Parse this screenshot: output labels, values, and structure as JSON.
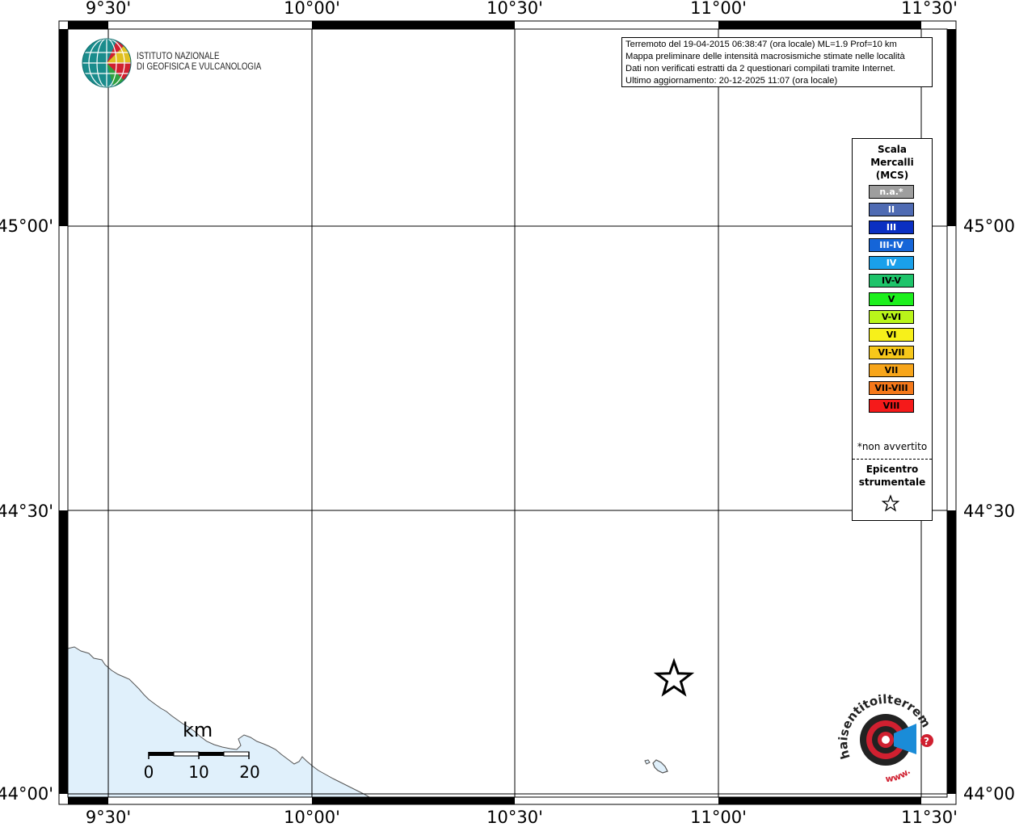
{
  "top_labels": [
    "9°30'",
    "10°00'",
    "10°30'",
    "11°00'",
    "11°30'"
  ],
  "bottom_labels": [
    "9°30'",
    "10°00'",
    "10°30'",
    "11°00'",
    "11°30'"
  ],
  "left_labels": [
    "45°00'",
    "44°30'",
    "44°00'"
  ],
  "right_labels": [
    "45°00'",
    "44°30'",
    "44°00'"
  ],
  "info": {
    "line1": "Terremoto del 19-04-2015 06:38:47 (ora locale) ML=1.9 Prof=10 km",
    "line2": "Mappa preliminare delle intensità macrosismiche stimate nelle località",
    "line3": "Dati non verificati estratti da 2 questionari compilati tramite Internet.",
    "line4": "Ultimo aggiornamento: 20-12-2025 11:07 (ora locale)"
  },
  "legend": {
    "title1": "Scala",
    "title2": "Mercalli",
    "title3": "(MCS)",
    "items": [
      {
        "label": "n.a.*",
        "color": "#9e9e9e",
        "text_color": "#ffffff"
      },
      {
        "label": "II",
        "color": "#4f6bb3",
        "text_color": "#ffffff"
      },
      {
        "label": "III",
        "color": "#0a2fc2",
        "text_color": "#ffffff"
      },
      {
        "label": "III-IV",
        "color": "#1565d8",
        "text_color": "#ffffff"
      },
      {
        "label": "IV",
        "color": "#1aa0ea",
        "text_color": "#ffffff"
      },
      {
        "label": "IV-V",
        "color": "#1ec46a",
        "text_color": "#000000"
      },
      {
        "label": "V",
        "color": "#1cf01c",
        "text_color": "#000000"
      },
      {
        "label": "V-VI",
        "color": "#b9f51a",
        "text_color": "#000000"
      },
      {
        "label": "VI",
        "color": "#f7f01a",
        "text_color": "#000000"
      },
      {
        "label": "VI-VII",
        "color": "#f7c81a",
        "text_color": "#000000"
      },
      {
        "label": "VII",
        "color": "#f7a51a",
        "text_color": "#000000"
      },
      {
        "label": "VII-VIII",
        "color": "#f5781a",
        "text_color": "#000000"
      },
      {
        "label": "VIII",
        "color": "#f51a1a",
        "text_color": "#000000"
      }
    ],
    "note": "*non avvertito",
    "epicenter1": "Epicentro",
    "epicenter2": "strumentale"
  },
  "logo": {
    "line1": "ISTITUTO NAZIONALE",
    "line2": "DI GEOFISICA E VULCANOLOGIA"
  },
  "scale_bar": {
    "unit": "km",
    "ticks": [
      "0",
      "10",
      "20"
    ]
  },
  "hst_logo": {
    "text": "haisentitoilterremoto.it",
    "www": "www."
  },
  "colors": {
    "sea": "#e0f0fb",
    "frame": "#000000",
    "epicenter": "#000000"
  }
}
